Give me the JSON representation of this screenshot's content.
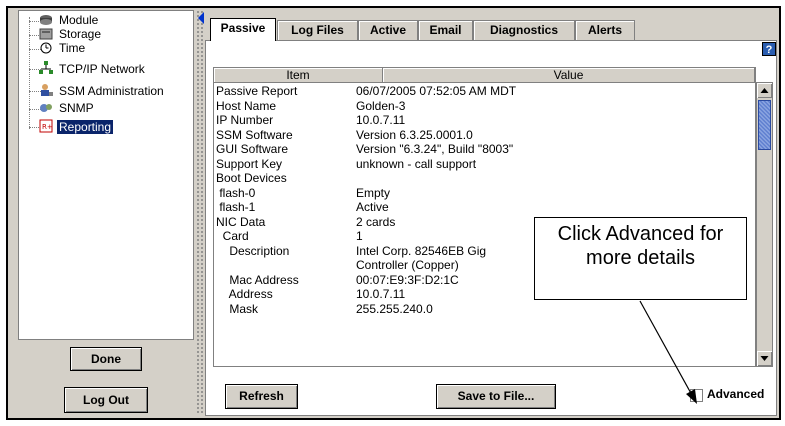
{
  "tree": {
    "items": [
      {
        "label": "Module",
        "icon": "module-icon"
      },
      {
        "label": "Storage",
        "icon": "storage-icon"
      },
      {
        "label": "Time",
        "icon": "clock-icon"
      },
      {
        "label": "TCP/IP Network",
        "icon": "network-icon"
      },
      {
        "label": "SSM Administration",
        "icon": "admin-icon"
      },
      {
        "label": "SNMP",
        "icon": "snmp-icon"
      },
      {
        "label": "Reporting",
        "icon": "report-icon",
        "selected": true
      }
    ]
  },
  "left_buttons": {
    "done": "Done",
    "logout": "Log Out"
  },
  "tabs": [
    {
      "label": "Passive",
      "active": true
    },
    {
      "label": "Log Files"
    },
    {
      "label": "Active"
    },
    {
      "label": "Email"
    },
    {
      "label": "Diagnostics"
    },
    {
      "label": "Alerts"
    }
  ],
  "help_label": "?",
  "table": {
    "headers": [
      "Item",
      "Value"
    ],
    "rows": [
      [
        "Passive Report",
        "06/07/2005 07:52:05 AM MDT"
      ],
      [
        "Host Name",
        "Golden-3"
      ],
      [
        "IP Number",
        "10.0.7.11"
      ],
      [
        "SSM Software",
        "Version 6.3.25.0001.0"
      ],
      [
        "GUI Software",
        "Version \"6.3.24\", Build \"8003\""
      ],
      [
        "Support Key",
        "unknown - call support"
      ],
      [
        "Boot Devices",
        ""
      ],
      [
        " flash-0",
        "Empty"
      ],
      [
        " flash-1",
        "Active"
      ],
      [
        "NIC Data",
        "2 cards"
      ],
      [
        "  Card",
        "1"
      ],
      [
        "    Description",
        "Intel Corp. 82546EB Gig"
      ],
      [
        "",
        "Controller (Copper)"
      ],
      [
        "    Mac Address",
        "00:07:E9:3F:D2:1C"
      ],
      [
        "    Address",
        "10.0.7.11"
      ],
      [
        "    Mask",
        "255.255.240.0"
      ]
    ]
  },
  "bottom": {
    "refresh": "Refresh",
    "save": "Save to File...",
    "advanced": "Advanced"
  },
  "callout": {
    "line1": "Click Advanced for",
    "line2": "more details"
  },
  "colors": {
    "selection": "#0a246a",
    "scroll_thumb": "#8aa4e0",
    "panel": "#d4d0c8"
  }
}
